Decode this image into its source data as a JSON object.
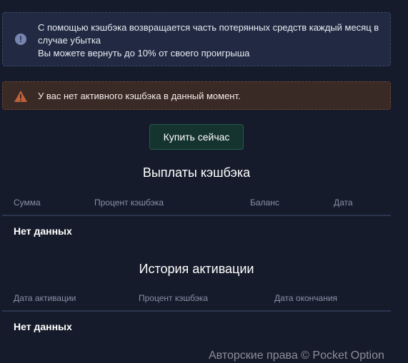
{
  "info_alert": {
    "line1": "С помощью кэшбэка возвращается часть потерянных средств каждый месяц в случае убытка",
    "line2": "Вы можете вернуть до 10% от своего проигрыша",
    "icon": "info-icon"
  },
  "warning_alert": {
    "text": "У вас нет активного кэшбэка в данный момент.",
    "icon": "warning-icon"
  },
  "buy_button": {
    "label": "Купить сейчас"
  },
  "payouts": {
    "title": "Выплаты кэшбэка",
    "columns": [
      "Сумма",
      "Процент кэшбэка",
      "Баланс",
      "Дата"
    ],
    "empty_text": "Нет данных"
  },
  "activation_history": {
    "title": "История активации",
    "columns": [
      "Дата активации",
      "Процент кэшбэка",
      "Дата окончания"
    ],
    "empty_text": "Нет данных"
  },
  "footer": {
    "copyright": "Авторские права © Pocket Option"
  },
  "colors": {
    "background": "#161b2b",
    "info_bg": "#212a42",
    "warning_bg": "#3a2a26",
    "warning_icon": "#c0603a",
    "button_bg": "#16342f"
  }
}
